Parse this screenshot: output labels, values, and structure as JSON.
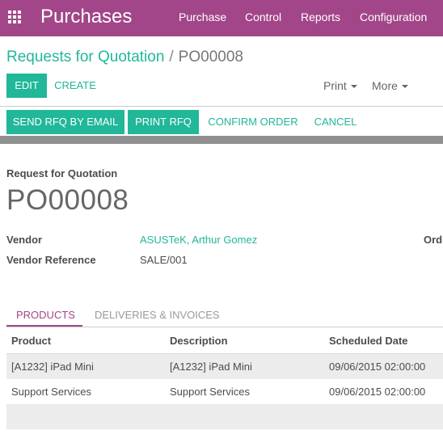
{
  "app": {
    "title": "Purchases",
    "menu": [
      "Purchase",
      "Control",
      "Reports",
      "Configuration"
    ]
  },
  "breadcrumb": {
    "parent": "Requests for Quotation",
    "separator": "/",
    "current": "PO00008"
  },
  "actions": {
    "edit": "EDIT",
    "create": "CREATE",
    "print": "Print",
    "more": "More"
  },
  "statusbar_buttons": {
    "send_email": "SEND RFQ BY EMAIL",
    "print_rfq": "PRINT RFQ",
    "confirm_order": "CONFIRM ORDER",
    "cancel": "CANCEL"
  },
  "form": {
    "doc_type": "Request for Quotation",
    "name": "PO00008",
    "vendor_label": "Vendor",
    "vendor_value": "ASUSTeK, Arthur Gomez",
    "vendor_ref_label": "Vendor Reference",
    "vendor_ref_value": "SALE/001",
    "order_label_partial": "Ord"
  },
  "tabs": {
    "products": "PRODUCTS",
    "deliveries": "DELIVERIES & INVOICES"
  },
  "table": {
    "headers": [
      "Product",
      "Description",
      "Scheduled Date"
    ],
    "rows": [
      [
        "[A1232] iPad Mini",
        "[A1232] iPad Mini",
        "09/06/2015 02:00:00"
      ],
      [
        "Support Services",
        "Support Services",
        "09/06/2015 02:00:00"
      ]
    ]
  },
  "colors": {
    "brand": "#a24689",
    "accent": "#21b799"
  },
  "icons": {
    "apps": "grid-apps-icon",
    "dropdown": "caret-down-icon"
  }
}
